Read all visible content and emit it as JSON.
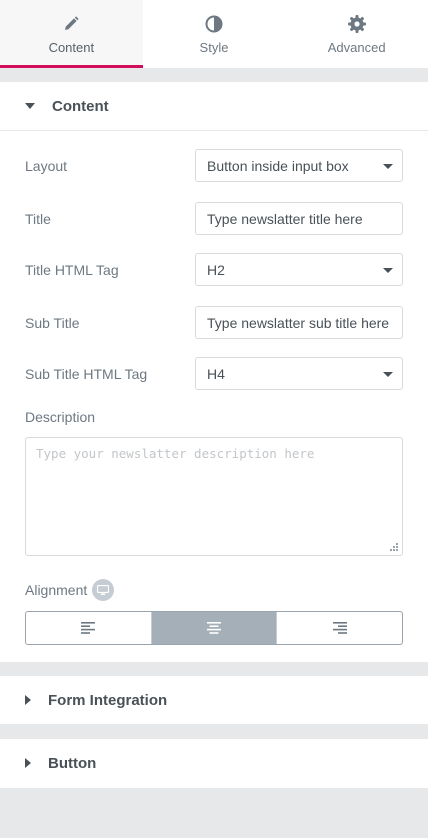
{
  "tabs": [
    {
      "label": "Content",
      "icon": "pencil-icon",
      "active": true
    },
    {
      "label": "Style",
      "icon": "contrast-icon",
      "active": false
    },
    {
      "label": "Advanced",
      "icon": "gear-icon",
      "active": false
    }
  ],
  "content_section": {
    "title": "Content",
    "fields": {
      "layout": {
        "label": "Layout",
        "value": "Button inside input box"
      },
      "title": {
        "label": "Title",
        "value": "Type newslatter title here"
      },
      "title_tag": {
        "label": "Title HTML Tag",
        "value": "H2"
      },
      "sub_title": {
        "label": "Sub Title",
        "value": "Type newslatter sub title here"
      },
      "sub_title_tag": {
        "label": "Sub Title HTML Tag",
        "value": "H4"
      },
      "description": {
        "label": "Description",
        "placeholder": "Type your newslatter description here",
        "value": ""
      },
      "alignment": {
        "label": "Alignment",
        "options": [
          "left",
          "center",
          "right"
        ],
        "selected": "center"
      }
    }
  },
  "sections_collapsed": [
    {
      "title": "Form Integration"
    },
    {
      "title": "Button"
    }
  ],
  "colors": {
    "accent": "#d30c5c",
    "panel_bg": "#e6e8ea",
    "active_align": "#a4afb7"
  }
}
